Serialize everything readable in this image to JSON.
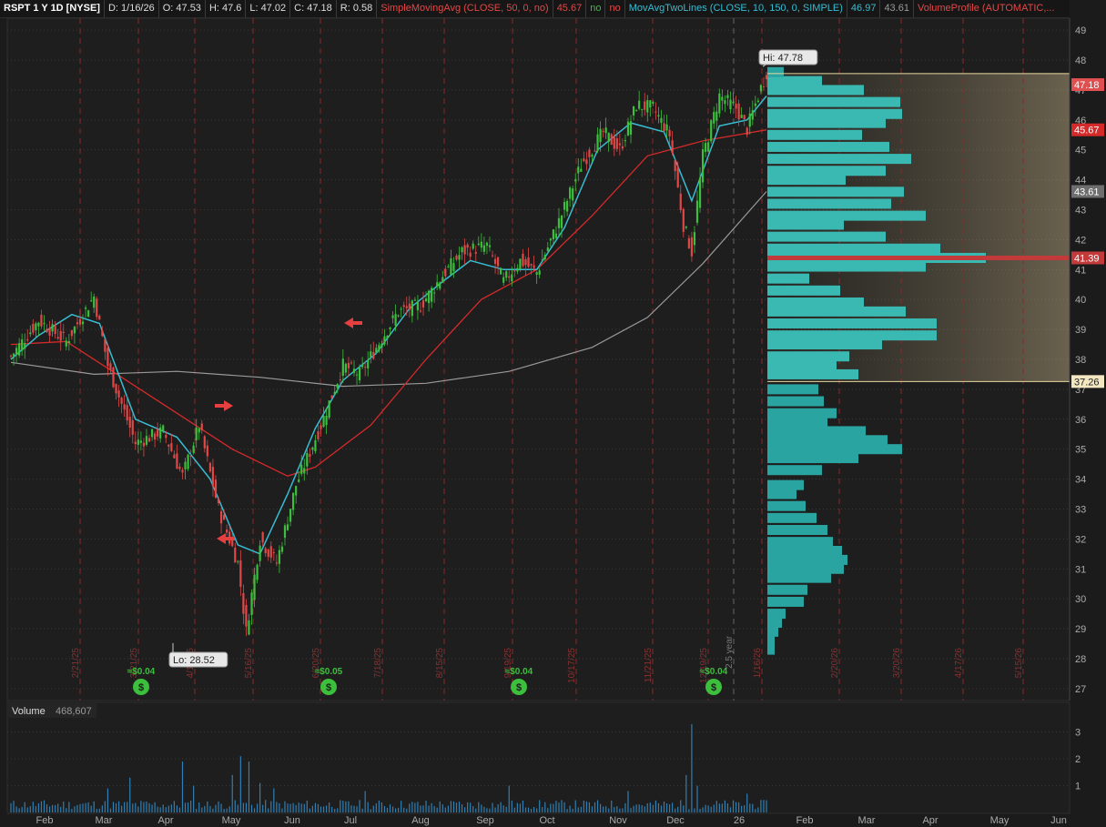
{
  "header": {
    "symbol": "RSPT 1 Y 1D [NYSE]",
    "date": "D: 1/16/26",
    "open": "O: 47.53",
    "high": "H: 47.6",
    "low": "L: 47.02",
    "close": "C: 47.18",
    "range": "R: 0.58",
    "sma_label": "SimpleMovingAvg (CLOSE, 50, 0, no)",
    "sma_value": "45.67",
    "sma_flag1": "no",
    "sma_flag2": "no",
    "mavg_label": "MovAvgTwoLines (CLOSE, 10, 150, 0, SIMPLE)",
    "mavg_value1": "46.97",
    "mavg_value2": "43.61",
    "vp_label": "VolumeProfile (AUTOMATIC,..."
  },
  "colors": {
    "up": "#3cbf3c",
    "down": "#e04848",
    "ma_fast": "#38bcd2",
    "ma_sma": "#d42a2a",
    "ma_slow": "#9a9a9a",
    "profile": "#2fb1ad",
    "poc": "#c23a3a"
  },
  "chart_data": {
    "type": "line",
    "price_axis": {
      "ylim": [
        26.6,
        49.4
      ],
      "ticks": [
        "27",
        "28",
        "29",
        "30",
        "31",
        "32",
        "33",
        "34",
        "35",
        "36",
        "37",
        "38",
        "39",
        "40",
        "41",
        "42",
        "43",
        "44",
        "45",
        "46",
        "47",
        "48",
        "49"
      ]
    },
    "x_labels": [
      "Feb",
      "Mar",
      "Apr",
      "May",
      "Jun",
      "Jul",
      "Aug",
      "Sep",
      "Oct",
      "Nov",
      "Dec",
      "26",
      "Feb",
      "Mar",
      "Apr",
      "May",
      "Jun"
    ],
    "price_series": [
      {
        "x": 0,
        "y": 38.1
      },
      {
        "x": 10,
        "y": 39.3
      },
      {
        "x": 20,
        "y": 38.6
      },
      {
        "x": 30,
        "y": 40.1
      },
      {
        "x": 35,
        "y": 37.8
      },
      {
        "x": 45,
        "y": 35.2
      },
      {
        "x": 55,
        "y": 35.6
      },
      {
        "x": 62,
        "y": 34.1
      },
      {
        "x": 68,
        "y": 35.8
      },
      {
        "x": 75,
        "y": 33.0
      },
      {
        "x": 82,
        "y": 31.2
      },
      {
        "x": 85,
        "y": 28.9
      },
      {
        "x": 90,
        "y": 32.0
      },
      {
        "x": 96,
        "y": 31.2
      },
      {
        "x": 103,
        "y": 33.8
      },
      {
        "x": 112,
        "y": 35.8
      },
      {
        "x": 120,
        "y": 37.8
      },
      {
        "x": 126,
        "y": 37.5
      },
      {
        "x": 132,
        "y": 38.4
      },
      {
        "x": 140,
        "y": 39.6
      },
      {
        "x": 148,
        "y": 39.8
      },
      {
        "x": 156,
        "y": 40.8
      },
      {
        "x": 163,
        "y": 41.6
      },
      {
        "x": 172,
        "y": 41.8
      },
      {
        "x": 178,
        "y": 40.6
      },
      {
        "x": 184,
        "y": 41.3
      },
      {
        "x": 190,
        "y": 40.9
      },
      {
        "x": 198,
        "y": 42.6
      },
      {
        "x": 206,
        "y": 44.5
      },
      {
        "x": 214,
        "y": 45.6
      },
      {
        "x": 220,
        "y": 45.0
      },
      {
        "x": 226,
        "y": 46.5
      },
      {
        "x": 232,
        "y": 46.4
      },
      {
        "x": 238,
        "y": 45.5
      },
      {
        "x": 243,
        "y": 42.5
      },
      {
        "x": 246,
        "y": 41.6
      },
      {
        "x": 250,
        "y": 44.8
      },
      {
        "x": 256,
        "y": 46.8
      },
      {
        "x": 262,
        "y": 46.4
      },
      {
        "x": 266,
        "y": 45.7
      },
      {
        "x": 270,
        "y": 46.8
      },
      {
        "x": 273,
        "y": 47.6
      }
    ],
    "series": [
      {
        "name": "MovAvgTwoLines (CLOSE, 10, 150, 0, SIMPLE)",
        "values": [
          {
            "x": 0,
            "y": 38.0
          },
          {
            "x": 10,
            "y": 38.8
          },
          {
            "x": 22,
            "y": 39.5
          },
          {
            "x": 32,
            "y": 39.2
          },
          {
            "x": 45,
            "y": 36.0
          },
          {
            "x": 60,
            "y": 35.4
          },
          {
            "x": 72,
            "y": 34.0
          },
          {
            "x": 82,
            "y": 31.8
          },
          {
            "x": 90,
            "y": 31.5
          },
          {
            "x": 100,
            "y": 33.5
          },
          {
            "x": 110,
            "y": 35.7
          },
          {
            "x": 120,
            "y": 37.3
          },
          {
            "x": 132,
            "y": 38.2
          },
          {
            "x": 144,
            "y": 39.7
          },
          {
            "x": 156,
            "y": 40.6
          },
          {
            "x": 166,
            "y": 41.3
          },
          {
            "x": 178,
            "y": 41.0
          },
          {
            "x": 190,
            "y": 41.0
          },
          {
            "x": 200,
            "y": 42.4
          },
          {
            "x": 212,
            "y": 45.0
          },
          {
            "x": 224,
            "y": 45.9
          },
          {
            "x": 236,
            "y": 45.6
          },
          {
            "x": 246,
            "y": 43.3
          },
          {
            "x": 256,
            "y": 45.8
          },
          {
            "x": 266,
            "y": 46.0
          },
          {
            "x": 273,
            "y": 46.8
          }
        ]
      },
      {
        "name": "SimpleMovingAvg (CLOSE, 50, 0, no)",
        "values": [
          {
            "x": 0,
            "y": 38.5
          },
          {
            "x": 20,
            "y": 38.6
          },
          {
            "x": 40,
            "y": 37.4
          },
          {
            "x": 60,
            "y": 36.2
          },
          {
            "x": 80,
            "y": 35.0
          },
          {
            "x": 100,
            "y": 34.1
          },
          {
            "x": 110,
            "y": 34.4
          },
          {
            "x": 130,
            "y": 35.8
          },
          {
            "x": 150,
            "y": 38.0
          },
          {
            "x": 170,
            "y": 40.0
          },
          {
            "x": 190,
            "y": 41.0
          },
          {
            "x": 210,
            "y": 42.8
          },
          {
            "x": 230,
            "y": 44.8
          },
          {
            "x": 250,
            "y": 45.3
          },
          {
            "x": 273,
            "y": 45.67
          }
        ]
      },
      {
        "name": "MovAvgTwoLines 150",
        "values": [
          {
            "x": 0,
            "y": 37.9
          },
          {
            "x": 30,
            "y": 37.5
          },
          {
            "x": 60,
            "y": 37.6
          },
          {
            "x": 90,
            "y": 37.4
          },
          {
            "x": 120,
            "y": 37.1
          },
          {
            "x": 150,
            "y": 37.2
          },
          {
            "x": 180,
            "y": 37.6
          },
          {
            "x": 210,
            "y": 38.4
          },
          {
            "x": 230,
            "y": 39.4
          },
          {
            "x": 250,
            "y": 41.2
          },
          {
            "x": 273,
            "y": 43.61
          }
        ]
      }
    ],
    "volume_profile": [
      {
        "y": 28.3,
        "w": 8
      },
      {
        "y": 28.6,
        "w": 8
      },
      {
        "y": 28.9,
        "w": 12
      },
      {
        "y": 29.2,
        "w": 16
      },
      {
        "y": 29.5,
        "w": 20
      },
      {
        "y": 29.9,
        "w": 40
      },
      {
        "y": 30.3,
        "w": 44
      },
      {
        "y": 30.7,
        "w": 70
      },
      {
        "y": 31.0,
        "w": 84
      },
      {
        "y": 31.3,
        "w": 88
      },
      {
        "y": 31.6,
        "w": 82
      },
      {
        "y": 31.9,
        "w": 72
      },
      {
        "y": 32.3,
        "w": 66
      },
      {
        "y": 32.7,
        "w": 54
      },
      {
        "y": 33.1,
        "w": 42
      },
      {
        "y": 33.5,
        "w": 32
      },
      {
        "y": 33.8,
        "w": 40
      },
      {
        "y": 34.3,
        "w": 60
      },
      {
        "y": 34.7,
        "w": 100
      },
      {
        "y": 35.0,
        "w": 148
      },
      {
        "y": 35.3,
        "w": 132
      },
      {
        "y": 35.6,
        "w": 108
      },
      {
        "y": 35.9,
        "w": 66
      },
      {
        "y": 36.2,
        "w": 76
      },
      {
        "y": 36.6,
        "w": 62
      },
      {
        "y": 37.0,
        "w": 56
      },
      {
        "y": 37.5,
        "w": 100
      },
      {
        "y": 37.8,
        "w": 76
      },
      {
        "y": 38.1,
        "w": 90
      },
      {
        "y": 38.5,
        "w": 126
      },
      {
        "y": 38.8,
        "w": 186
      },
      {
        "y": 39.2,
        "w": 186
      },
      {
        "y": 39.6,
        "w": 152
      },
      {
        "y": 39.9,
        "w": 106
      },
      {
        "y": 40.3,
        "w": 80
      },
      {
        "y": 40.7,
        "w": 46
      },
      {
        "y": 41.1,
        "w": 174
      },
      {
        "y": 41.39,
        "w": 240
      },
      {
        "y": 41.7,
        "w": 190
      },
      {
        "y": 42.1,
        "w": 130
      },
      {
        "y": 42.5,
        "w": 84
      },
      {
        "y": 42.8,
        "w": 174
      },
      {
        "y": 43.2,
        "w": 136
      },
      {
        "y": 43.6,
        "w": 150
      },
      {
        "y": 44.0,
        "w": 86
      },
      {
        "y": 44.3,
        "w": 130
      },
      {
        "y": 44.7,
        "w": 158
      },
      {
        "y": 45.1,
        "w": 134
      },
      {
        "y": 45.5,
        "w": 104
      },
      {
        "y": 45.9,
        "w": 130
      },
      {
        "y": 46.2,
        "w": 148
      },
      {
        "y": 46.6,
        "w": 146
      },
      {
        "y": 47.0,
        "w": 106
      },
      {
        "y": 47.3,
        "w": 60
      },
      {
        "y": 47.6,
        "w": 18
      }
    ],
    "volume_axis": {
      "ylim": [
        0,
        3.5
      ],
      "ticks": [
        "1",
        "2",
        "3"
      ]
    }
  },
  "price_tags": [
    {
      "value": "47.18",
      "y": 47.18,
      "kind": "close"
    },
    {
      "value": "45.67",
      "y": 45.67,
      "kind": "sma"
    },
    {
      "value": "43.61",
      "y": 43.61,
      "kind": "slow"
    },
    {
      "value": "41.39",
      "y": 41.39,
      "kind": "poc"
    },
    {
      "value": "37.26",
      "y": 37.26,
      "kind": "val"
    }
  ],
  "callouts": {
    "hi": "Hi: 47.78",
    "lo": "Lo: 28.52"
  },
  "dividends": [
    "≈$0.04",
    "≈$0.05",
    "≈$0.04",
    "≈$0.04"
  ],
  "date_labels": [
    "2/21/25",
    "3/21/25",
    "4/17/25",
    "5/16/25",
    "6/20/25",
    "7/18/25",
    "8/15/25",
    "9/19/25",
    "10/17/25",
    "11/21/25",
    "12/19/25",
    "1/16/26",
    "2/20/26",
    "3/20/26",
    "4/17/26",
    "5/15/26"
  ],
  "year_label": "2.5 year",
  "volume": {
    "label": "Volume",
    "value": "468,607"
  }
}
